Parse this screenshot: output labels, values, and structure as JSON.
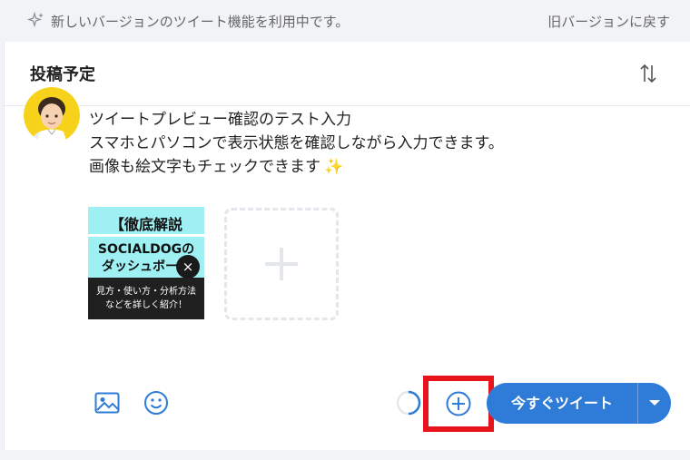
{
  "banner": {
    "message": "新しいバージョンのツイート機能を利用中です。",
    "back_link": "旧バージョンに戻す",
    "icon": "sparkle-icon"
  },
  "panel": {
    "title": "投稿予定",
    "sort_icon": "sort-arrows-icon"
  },
  "composer": {
    "lines": [
      "ツイートプレビュー確認のテスト入力",
      "スマホとパソコンで表示状態を確認しながら入力できます。",
      "画像も絵文字もチェックできます"
    ],
    "emoji": "✨",
    "attachment": {
      "line1": "【徹底解説",
      "line2": "SOCIALDOGの",
      "line3": "ダッシュボード",
      "line4": "見方・使い方・分析方法",
      "line5": "などを詳しく紹介！",
      "remove_glyph": "×"
    }
  },
  "toolbar": {
    "image_icon": "image-icon",
    "emoji_icon": "emoji-icon",
    "counter_icon": "character-counter-icon",
    "add_icon": "add-thread-icon",
    "tweet_label": "今すぐツイート",
    "dropdown_icon": "caret-down-icon"
  },
  "colors": {
    "accent": "#2f7bd8",
    "highlight": "#e8141c",
    "background": "#f1f3f7"
  }
}
